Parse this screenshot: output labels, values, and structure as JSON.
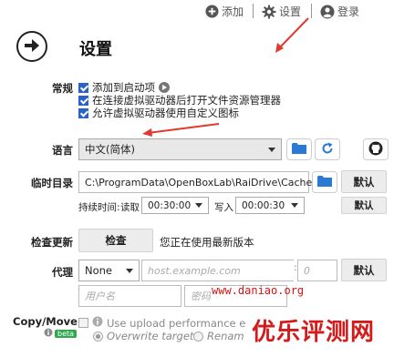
{
  "topbar": {
    "add_label": "添加",
    "settings_label": "设置",
    "login_label": "登录"
  },
  "page": {
    "title": "设置"
  },
  "general": {
    "label": "常规",
    "options": [
      "添加到启动项",
      "在连接虚拟驱动器后打开文件资源管理器",
      "允许虚拟驱动器使用自定义图标"
    ]
  },
  "language": {
    "label": "语言",
    "value": "中文(简体)"
  },
  "temp": {
    "label": "临时目录",
    "path": "C:\\ProgramData\\OpenBoxLab\\RaiDrive\\Cache",
    "default_label": "默认",
    "duration_label": "持续时间:",
    "read_label": "读取",
    "read_value": "00:30:00",
    "write_label": "写入",
    "write_value": "00:00:30",
    "default2_label": "默认"
  },
  "update": {
    "label": "检查更新",
    "button": "检查",
    "status": "您正在使用最新版本"
  },
  "proxy": {
    "label": "代理",
    "type": "None",
    "host_placeholder": "host.example.com",
    "port_placeholder": "0",
    "default_label": "默认",
    "user_placeholder": "用户名",
    "pass_placeholder": "密码"
  },
  "copymove": {
    "label": "Copy/Move",
    "badge": "beta",
    "option": "Use upload performance e",
    "radio1": "Overwrite target",
    "radio2": "Renam"
  },
  "watermark": {
    "url": "www.daniao.org",
    "brand": "优乐评测网"
  },
  "colors": {
    "accent": "#2a7ad5",
    "annotation": "#e03a2f",
    "watermark": "#d21414"
  }
}
